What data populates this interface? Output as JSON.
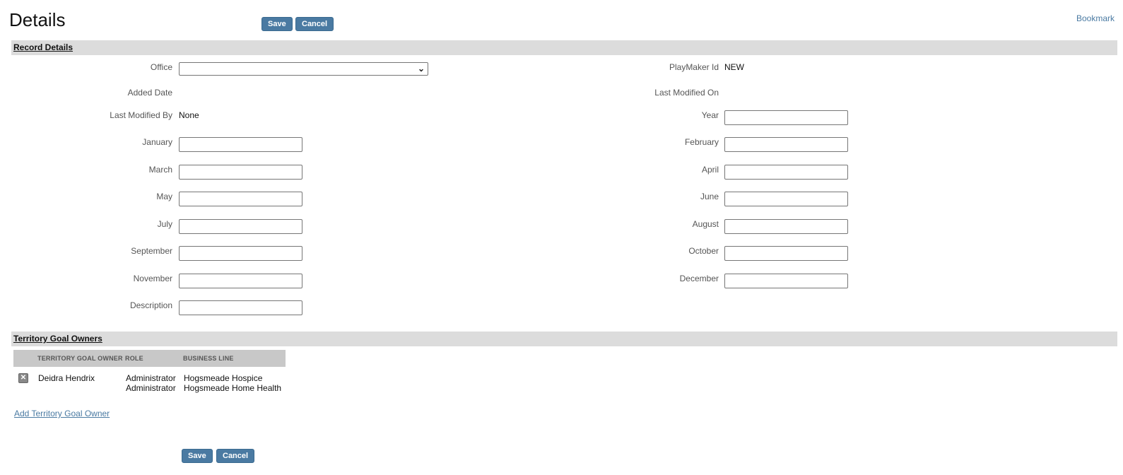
{
  "header": {
    "title": "Details",
    "save_label": "Save",
    "cancel_label": "Cancel",
    "bookmark_label": "Bookmark"
  },
  "record_details": {
    "section_title": "Record Details",
    "office_label": "Office",
    "office_value": "",
    "playmaker_id_label": "PlayMaker Id",
    "playmaker_id_value": "NEW",
    "added_date_label": "Added Date",
    "added_date_value": "",
    "last_modified_on_label": "Last Modified On",
    "last_modified_on_value": "",
    "last_modified_by_label": "Last Modified By",
    "last_modified_by_value": "None",
    "year_label": "Year",
    "january_label": "January",
    "february_label": "February",
    "march_label": "March",
    "april_label": "April",
    "may_label": "May",
    "june_label": "June",
    "july_label": "July",
    "august_label": "August",
    "september_label": "September",
    "october_label": "October",
    "november_label": "November",
    "december_label": "December",
    "description_label": "Description"
  },
  "owners": {
    "section_title": "Territory Goal Owners",
    "columns": [
      "TERRITORY GOAL OWNER",
      "ROLE",
      "BUSINESS LINE"
    ],
    "rows": [
      {
        "owner": "Deidra Hendrix",
        "roles": [
          "Administrator",
          "Administrator"
        ],
        "business_lines": [
          "Hogsmeade Hospice",
          "Hogsmeade Home Health"
        ]
      }
    ],
    "add_link": "Add Territory Goal Owner"
  },
  "footer": {
    "save_label": "Save",
    "cancel_label": "Cancel"
  },
  "colors": {
    "button": "#4a7aa2",
    "section_bar": "#dcdcdc",
    "table_header": "#c8c8c8",
    "link": "#4a7aa2"
  }
}
